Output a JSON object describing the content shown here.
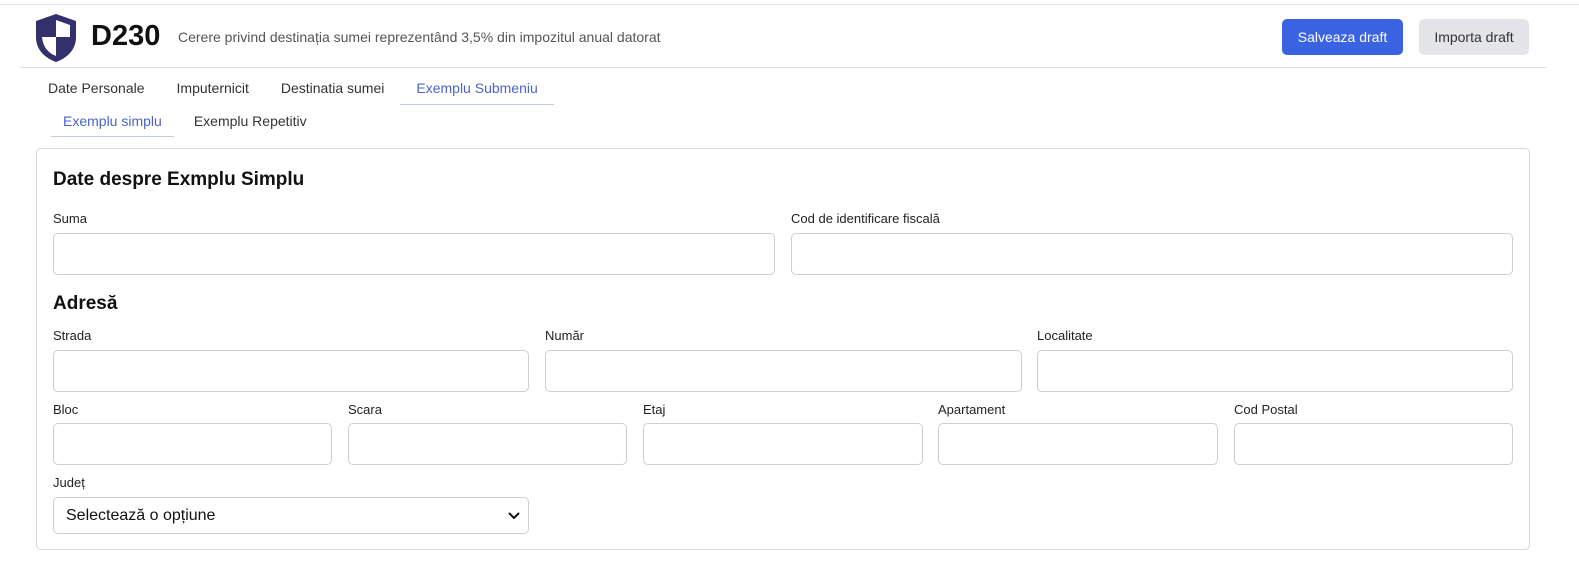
{
  "header": {
    "code": "D230",
    "subtitle": "Cerere privind destinația sumei reprezentând 3,5% din impozitul anual datorat",
    "save_label": "Salveaza draft",
    "import_label": "Importa draft",
    "logo_icon": "shield-icon",
    "colors": {
      "logo": "#33306d",
      "primary": "#3a63e2",
      "secondary": "#e4e5e8",
      "active_tab": "#4a64c8"
    }
  },
  "tabs": [
    {
      "label": "Date Personale",
      "active": false
    },
    {
      "label": "Imputernicit",
      "active": false
    },
    {
      "label": "Destinatia sumei",
      "active": false
    },
    {
      "label": "Exemplu Submeniu",
      "active": true
    }
  ],
  "subtabs": [
    {
      "label": "Exemplu simplu",
      "active": true
    },
    {
      "label": "Exemplu Repetitiv",
      "active": false
    }
  ],
  "form": {
    "section_title": "Date despre Exmplu Simplu",
    "suma_label": "Suma",
    "suma_value": "",
    "cif_label": "Cod de identificare fiscală",
    "cif_value": "",
    "address_title": "Adresă",
    "strada_label": "Strada",
    "numar_label": "Număr",
    "localitate_label": "Localitate",
    "bloc_label": "Bloc",
    "scara_label": "Scara",
    "etaj_label": "Etaj",
    "apartament_label": "Apartament",
    "cod_postal_label": "Cod Postal",
    "judet_label": "Județ",
    "judet_selected": "Selectează o opțiune",
    "judet_icon": "chevron-down-icon"
  }
}
